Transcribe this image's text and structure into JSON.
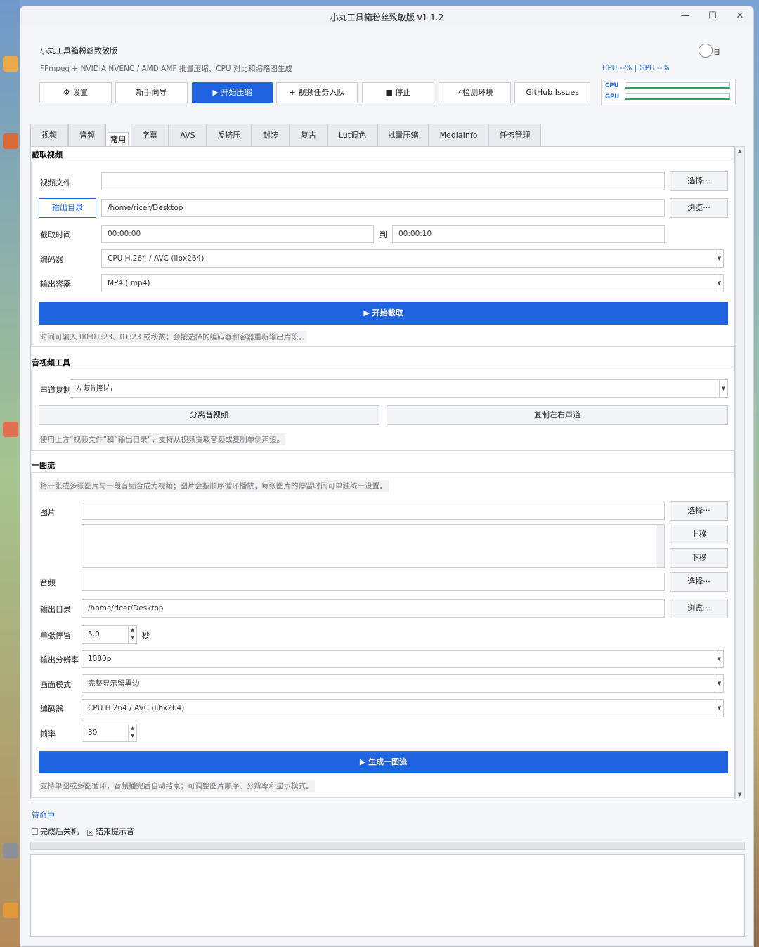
{
  "window": {
    "title": "小丸工具箱粉丝致敬版 v1.1.2",
    "minimize": "—",
    "maximize": "☐",
    "close": "✕"
  },
  "header": {
    "app_name": "小丸工具箱粉丝致敬版",
    "subtitle": "FFmpeg + NVIDIA NVENC / AMD AMF 批量压缩、CPU 对比和缩略图生成",
    "theme_label": "日",
    "monitor_text": "CPU --% | GPU --%",
    "cpu_label": "CPU",
    "gpu_label": "GPU"
  },
  "toolbar": [
    {
      "label": "⚙ 设置"
    },
    {
      "label": "新手向导"
    },
    {
      "label": "▶ 开始压缩"
    },
    {
      "label": "+ 视频任务入队"
    },
    {
      "label": "■ 停止"
    },
    {
      "label": "✓检测环境"
    },
    {
      "label": "GitHub Issues"
    }
  ],
  "tabs": [
    "视频",
    "音频",
    "常用",
    "字幕",
    "AVS",
    "反挤压",
    "封装",
    "复古",
    "Lut调色",
    "批量压缩",
    "MediaInfo",
    "任务管理"
  ],
  "clip": {
    "title": "截取视频",
    "video_file_label": "视频文件",
    "video_file_value": "",
    "select_btn": "选择···",
    "output_dir_btn": "输出目录",
    "output_dir_value": "/home/ricer/Desktop",
    "browse_btn": "浏览···",
    "time_label": "截取时间",
    "start_time": "00:00:00",
    "to_label": "到",
    "end_time": "00:00:10",
    "encoder_label": "编码器",
    "encoder_value": "CPU H.264 / AVC (libx264)",
    "container_label": "输出容器",
    "container_value": "MP4 (.mp4)",
    "start_btn": "▶ 开始截取",
    "hint": "时间可输入 00:01:23、01:23 或秒数；会按选择的编码器和容器重新输出片段。"
  },
  "av_tools": {
    "title": "音视频工具",
    "channel_label": "声道复制",
    "channel_value": "左复制到右",
    "split_btn": "分离音视频",
    "copy_btn": "复制左右声道",
    "hint": "使用上方“视频文件”和“输出目录”；支持从视频提取音频或复制单侧声道。"
  },
  "slideshow": {
    "title": "一图流",
    "hint_top": "将一张或多张图片与一段音频合成为视频；图片会按顺序循环播放，每张图片的停留时间可单独统一设置。",
    "image_label": "图片",
    "image_value": "",
    "select_btn": "选择···",
    "up_btn": "上移",
    "down_btn": "下移",
    "audio_label": "音频",
    "audio_value": "",
    "audio_select_btn": "选择···",
    "output_dir_label": "输出目录",
    "output_dir_value": "/home/ricer/Desktop",
    "browse_btn": "浏览···",
    "duration_label": "单张停留",
    "duration_value": "5.0",
    "duration_unit": "秒",
    "resolution_label": "输出分辨率",
    "resolution_value": "1080p",
    "mode_label": "画面模式",
    "mode_value": "完整显示留黑边",
    "encoder_label": "编码器",
    "encoder_value": "CPU H.264 / AVC (libx264)",
    "fps_label": "帧率",
    "fps_value": "30",
    "generate_btn": "▶ 生成一图流",
    "hint_bottom": "支持单图或多图循环，音频播完后自动结束；可调整图片顺序、分辨率和显示模式。"
  },
  "footer": {
    "status": "待命中",
    "shutdown_label": "完成后关机",
    "sound_label": "结束提示音",
    "sound_mark": "✕"
  },
  "colors": {
    "accent": "#1f63e0",
    "link": "#2467d8"
  }
}
